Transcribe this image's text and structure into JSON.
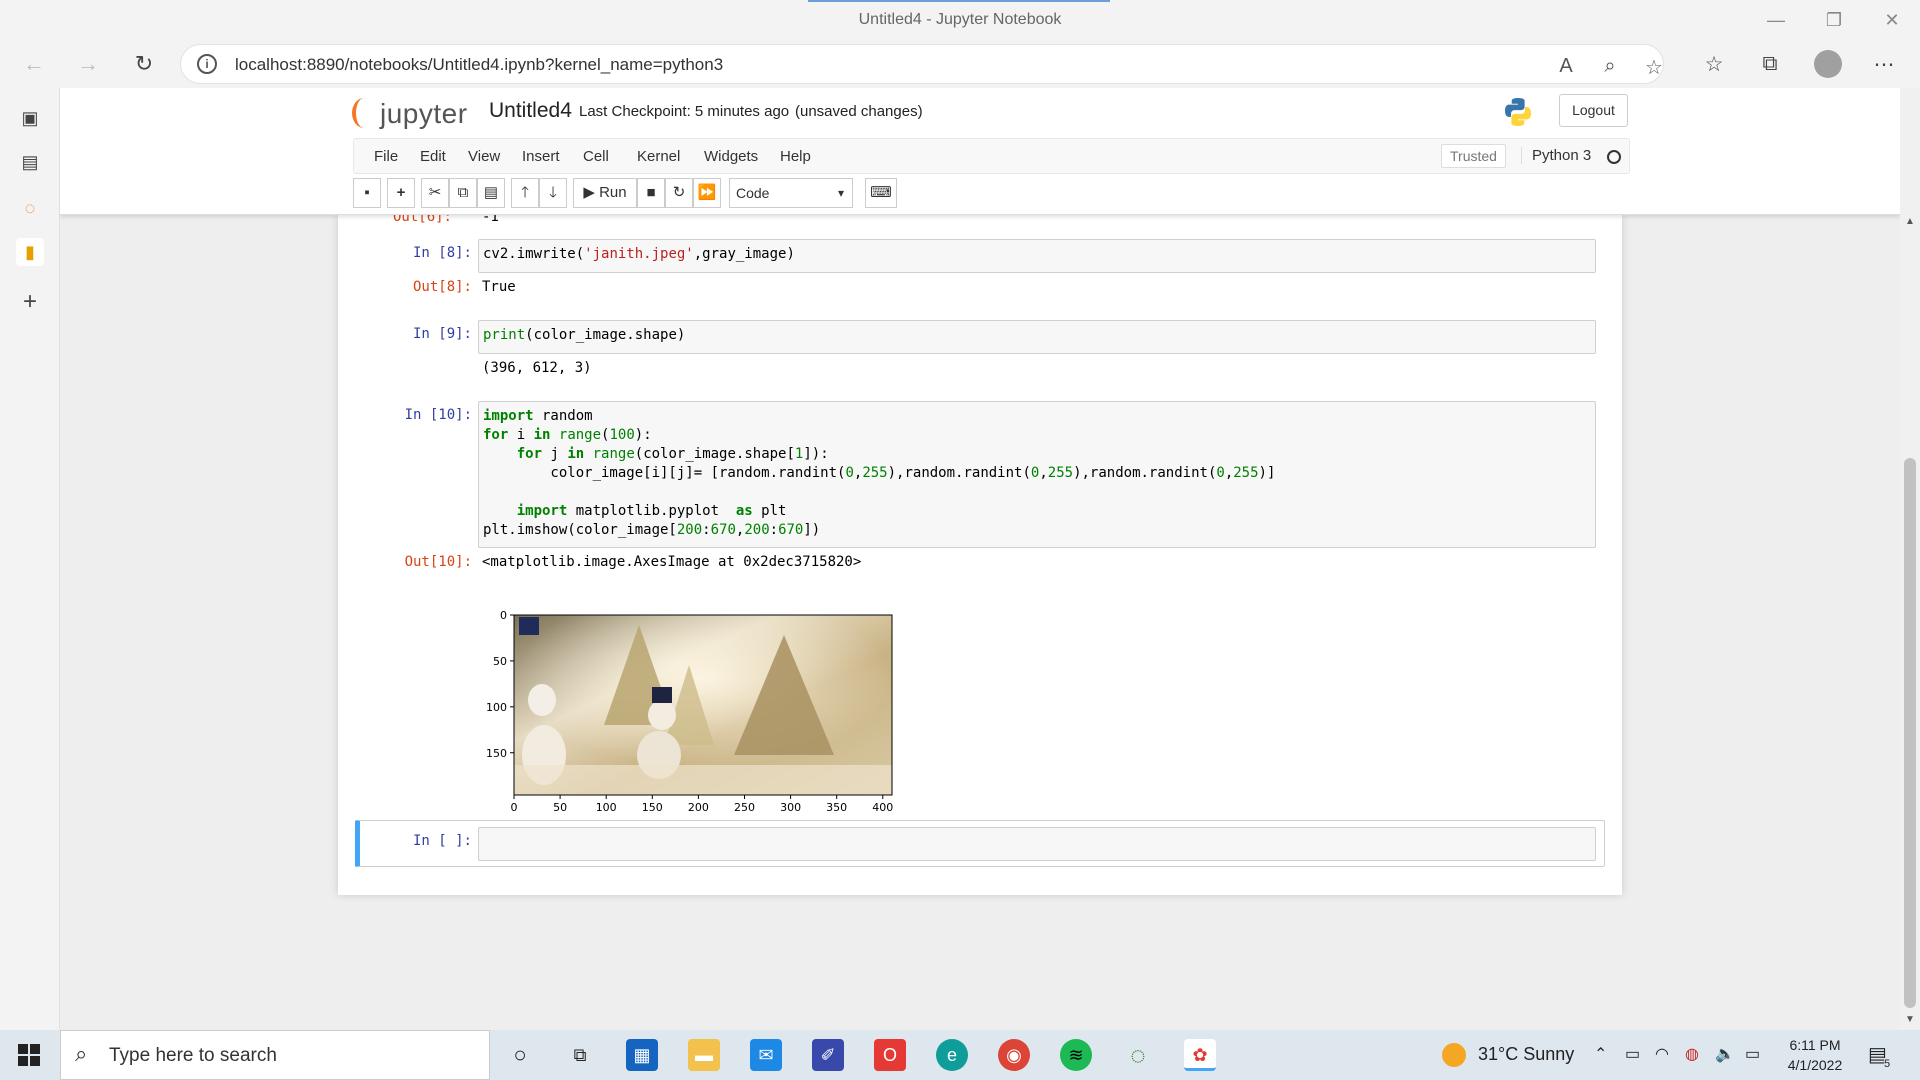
{
  "browser": {
    "window_title": "Untitled4 - Jupyter Notebook",
    "url": "localhost:8890/notebooks/Untitled4.ipynb?kernel_name=python3"
  },
  "jupyter": {
    "logo_text": "jupyter",
    "notebook_name": "Untitled4",
    "checkpoint": "Last Checkpoint: 5 minutes ago",
    "unsaved": "(unsaved changes)",
    "logout": "Logout",
    "menu": [
      "File",
      "Edit",
      "View",
      "Insert",
      "Cell",
      "Kernel",
      "Widgets",
      "Help"
    ],
    "trusted": "Trusted",
    "kernel": "Python 3",
    "run_label": "Run",
    "cell_type": "Code"
  },
  "cells": {
    "out6_prompt": "Out[6]:",
    "out6_text": "-1",
    "in8_prompt": "In [8]:",
    "out8_prompt": "Out[8]:",
    "out8_text": "True",
    "in9_prompt": "In [9]:",
    "out9_text": "(396, 612, 3)",
    "in10_prompt": "In [10]:",
    "out10_prompt": "Out[10]:",
    "out10_text": "<matplotlib.image.AxesImage at 0x2dec3715820>",
    "empty_prompt": "In [ ]:"
  },
  "chart_data": {
    "type": "image",
    "x_ticks": [
      0,
      50,
      100,
      150,
      200,
      250,
      300,
      350,
      400
    ],
    "y_ticks": [
      0,
      50,
      100,
      150
    ],
    "xlim": [
      0,
      410
    ],
    "ylim": [
      0,
      196
    ],
    "image_description_colors": [
      "#c8b48a",
      "#e8dcc0",
      "#9a8a64"
    ]
  },
  "taskbar": {
    "search_placeholder": "Type here to search",
    "weather": "31°C  Sunny",
    "time": "6:11 PM",
    "date": "4/1/2022",
    "notifications": "5"
  }
}
